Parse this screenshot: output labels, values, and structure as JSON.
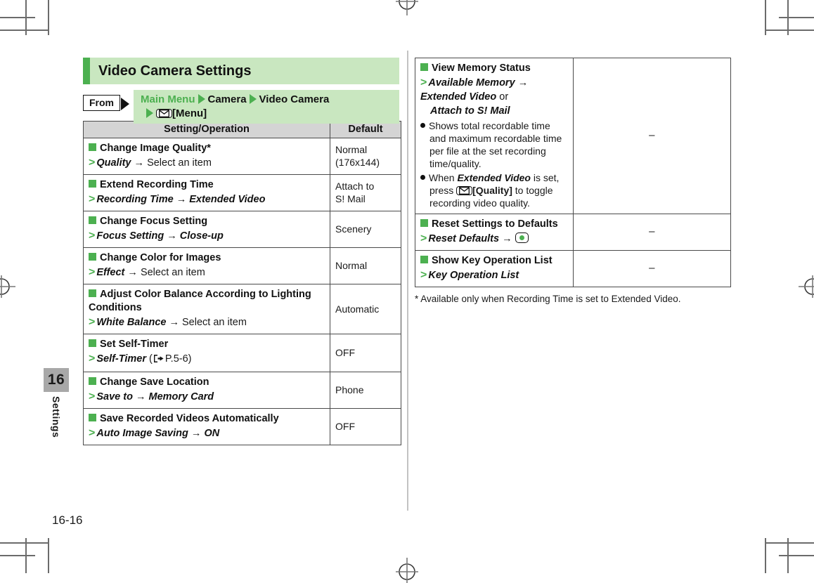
{
  "page": {
    "number": "16-16",
    "tab_number": "16",
    "tab_label": "Settings",
    "accent_green": "#4cb050",
    "title_band": "#c9e7c0",
    "header_gray": "#d4d4d4"
  },
  "header": {
    "title": "Video Camera Settings",
    "from_label": "From",
    "breadcrumb": {
      "root": "Main Menu",
      "level2": "Camera",
      "level3": "Video Camera",
      "key_icon": "envelope-icon",
      "key_label": "[Menu]"
    }
  },
  "table": {
    "columns": [
      "Setting/Operation",
      "Default"
    ],
    "rows": [
      {
        "title": "Change Image Quality*",
        "path_bold": "Quality",
        "path_arrow": "→",
        "path_plain": "Select an item",
        "default": "Normal\n(176x144)"
      },
      {
        "title": "Extend Recording Time",
        "path_bold": "Recording Time",
        "path_arrow": "→",
        "path_bold2": "Extended Video",
        "default": "Attach to\nS! Mail"
      },
      {
        "title": "Change Focus Setting",
        "path_bold": "Focus Setting",
        "path_arrow": "→",
        "path_bold2": "Close-up",
        "default": "Scenery"
      },
      {
        "title": "Change Color for Images",
        "path_bold": "Effect",
        "path_arrow": "→",
        "path_plain": "Select an item",
        "default": "Normal"
      },
      {
        "title": "Adjust Color Balance According to Lighting Conditions",
        "path_bold": "White Balance",
        "path_arrow": "→",
        "path_plain": "Select an item",
        "default": "Automatic"
      },
      {
        "title": "Set Self-Timer",
        "path_bold": "Self-Timer",
        "path_ref_open": "(",
        "path_ref": "P.5-6",
        "path_ref_close": ")",
        "ref_icon": "pointing-hand-icon",
        "default": "OFF"
      },
      {
        "title": "Change Save Location",
        "path_bold": "Save to",
        "path_arrow": "→",
        "path_bold2": "Memory Card",
        "default": "Phone"
      },
      {
        "title": "Save Recorded Videos Automatically",
        "path_bold": "Auto Image Saving",
        "path_arrow": "→",
        "path_bold2": "ON",
        "default": "OFF"
      }
    ]
  },
  "table_right": {
    "rows": [
      {
        "title": "View Memory Status",
        "path_bold": "Available Memory",
        "path_arrow": "→",
        "path_bold2": "Extended Video",
        "path_plain": "or",
        "path_bold3": "Attach to S! Mail",
        "notes": [
          "Shows total recordable time and maximum recordable time per file at the set recording time/quality.",
          "When Extended Video is set, press [Quality] to toggle recording video quality."
        ],
        "note2_parts": {
          "pre": "When ",
          "bold": "Extended Video",
          "mid": " is set, press ",
          "key_icon": "envelope-icon",
          "key_label": "[Quality]",
          "post": " to toggle recording video quality."
        },
        "default": "–"
      },
      {
        "title": "Reset Settings to Defaults",
        "path_bold": "Reset Defaults",
        "path_arrow": "→",
        "key_icon": "center-select-key-icon",
        "default": "–"
      },
      {
        "title": "Show Key Operation List",
        "path_bold": "Key Operation List",
        "default": "–"
      }
    ],
    "footnote": "*  Available only when Recording Time is set to Extended Video."
  }
}
